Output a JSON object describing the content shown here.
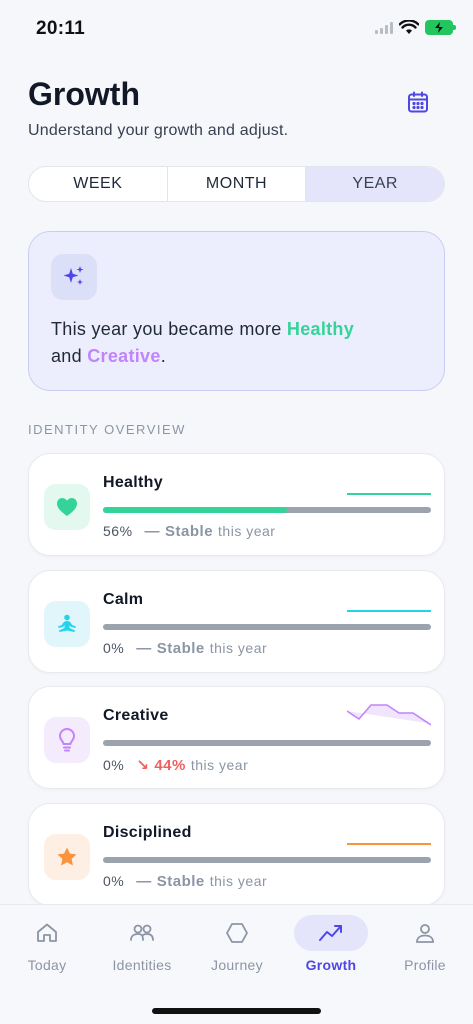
{
  "status": {
    "time": "20:11"
  },
  "header": {
    "title": "Growth",
    "subtitle": "Understand your growth and adjust."
  },
  "periods": {
    "week": "WEEK",
    "month": "MONTH",
    "year": "YEAR",
    "selected": "YEAR"
  },
  "insight": {
    "prefix": "This year you became more ",
    "highlight1": "Healthy",
    "middle": "\nand ",
    "highlight2": "Creative",
    "suffix": "."
  },
  "section_label": "IDENTITY OVERVIEW",
  "identities": [
    {
      "name": "Healthy",
      "percent_text": "56%",
      "progress": 0.56,
      "trend_icon": "—",
      "trend_text": "Stable",
      "suffix": "this year",
      "trend_kind": "stable",
      "color": "#34d399",
      "icon_bg": "#e3f8ef",
      "icon": "heart-icon"
    },
    {
      "name": "Calm",
      "percent_text": "0%",
      "progress": 0,
      "trend_icon": "—",
      "trend_text": "Stable",
      "suffix": "this year",
      "trend_kind": "stable",
      "color": "#22d3ee",
      "icon_bg": "#e0f6fb",
      "icon": "meditation-icon"
    },
    {
      "name": "Creative",
      "percent_text": "0%",
      "progress": 0,
      "trend_icon": "↘",
      "trend_text": "44%",
      "suffix": "this year",
      "trend_kind": "down",
      "color": "#c084fc",
      "icon_bg": "#f4ebfd",
      "icon": "lightbulb-icon"
    },
    {
      "name": "Disciplined",
      "percent_text": "0%",
      "progress": 0,
      "trend_icon": "—",
      "trend_text": "Stable",
      "suffix": "this year",
      "trend_kind": "stable",
      "color": "#fb923c",
      "icon_bg": "#fdefe4",
      "icon": "star-icon"
    }
  ],
  "tabs": [
    {
      "label": "Today",
      "icon": "home-icon"
    },
    {
      "label": "Identities",
      "icon": "people-icon"
    },
    {
      "label": "Journey",
      "icon": "hexagon-icon"
    },
    {
      "label": "Growth",
      "icon": "trend-icon",
      "active": true
    },
    {
      "label": "Profile",
      "icon": "person-icon"
    }
  ],
  "colors": {
    "accent": "#4f46e5",
    "accent_soft": "#e4e5fa",
    "healthy": "#34d399",
    "creative": "#c084fc",
    "down": "#ef5f5f"
  }
}
